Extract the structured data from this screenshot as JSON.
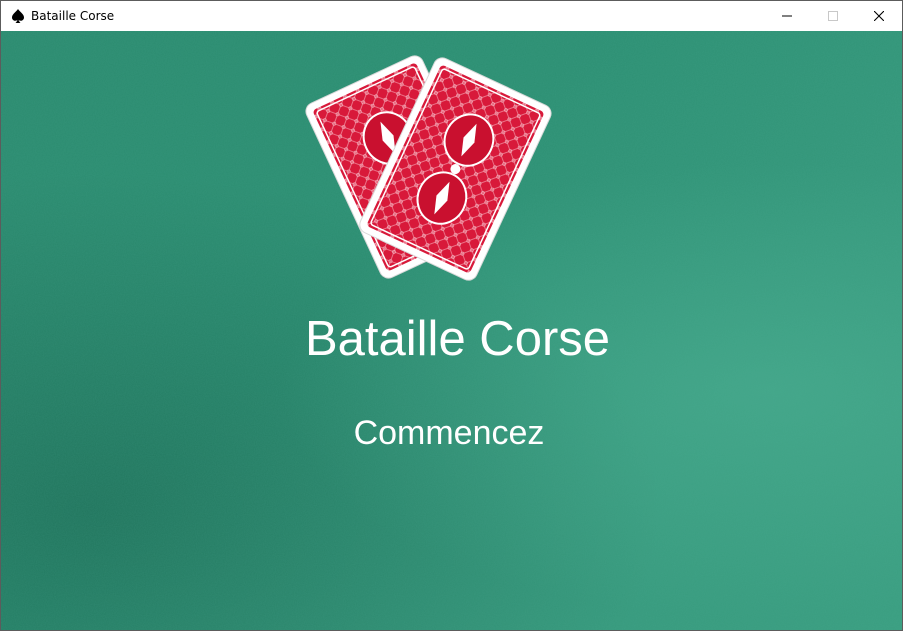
{
  "window": {
    "title": "Bataille Corse",
    "icon": "spade-icon",
    "controls": [
      "minimize-icon",
      "maximize-icon",
      "close-icon"
    ]
  },
  "main": {
    "title": "Bataille Corse",
    "start_label": "Commencez",
    "background": "green-felt",
    "illustration": "two-red-card-backs"
  },
  "colors": {
    "felt": "#2c8f72",
    "card_back": "#d8193a",
    "text": "#ffffff"
  }
}
